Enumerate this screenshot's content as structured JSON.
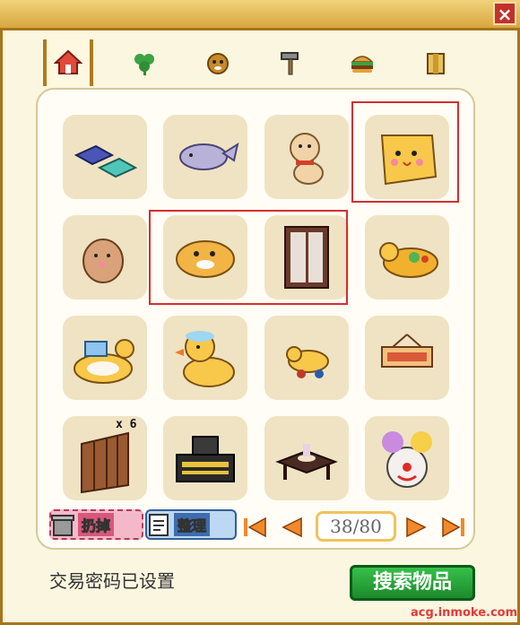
{
  "window": {
    "close_label": "×"
  },
  "tabs": [
    {
      "icon": "house-icon",
      "active": true
    },
    {
      "icon": "clover-icon",
      "active": false
    },
    {
      "icon": "pet-face-icon",
      "active": false
    },
    {
      "icon": "hammer-icon",
      "active": false
    },
    {
      "icon": "burger-icon",
      "active": false
    },
    {
      "icon": "box-icon",
      "active": false
    }
  ],
  "inventory": {
    "items": [
      {
        "icon": "blue-bed-item-icon",
        "highlighted": false
      },
      {
        "icon": "shark-item-icon",
        "highlighted": false
      },
      {
        "icon": "puppy-plush-item-icon",
        "highlighted": false
      },
      {
        "icon": "bear-face-cushion-item-icon",
        "highlighted": true
      },
      {
        "icon": "hamster-plush-item-icon",
        "highlighted": false
      },
      {
        "icon": "bear-cushion-item-icon",
        "highlighted": true
      },
      {
        "icon": "window-frame-item-icon",
        "highlighted": true
      },
      {
        "icon": "duck-boat-item-icon",
        "highlighted": false
      },
      {
        "icon": "duck-float-item-icon",
        "highlighted": false
      },
      {
        "icon": "rubber-duck-item-icon",
        "highlighted": false
      },
      {
        "icon": "duck-toy-car-item-icon",
        "highlighted": false
      },
      {
        "icon": "sign-board-item-icon",
        "highlighted": false
      },
      {
        "icon": "wooden-fence-item-icon",
        "highlighted": false,
        "count": "x 6"
      },
      {
        "icon": "music-machine-item-icon",
        "highlighted": false
      },
      {
        "icon": "tea-table-item-icon",
        "highlighted": false
      },
      {
        "icon": "clown-head-item-icon",
        "highlighted": false
      }
    ]
  },
  "buttons": {
    "discard_label": "扔掉",
    "sort_label": "整理"
  },
  "pager": {
    "page": "38/80"
  },
  "footer": {
    "status": "交易密码已设置",
    "search_label": "搜索物品"
  },
  "watermark": "acg.inmoke.com"
}
